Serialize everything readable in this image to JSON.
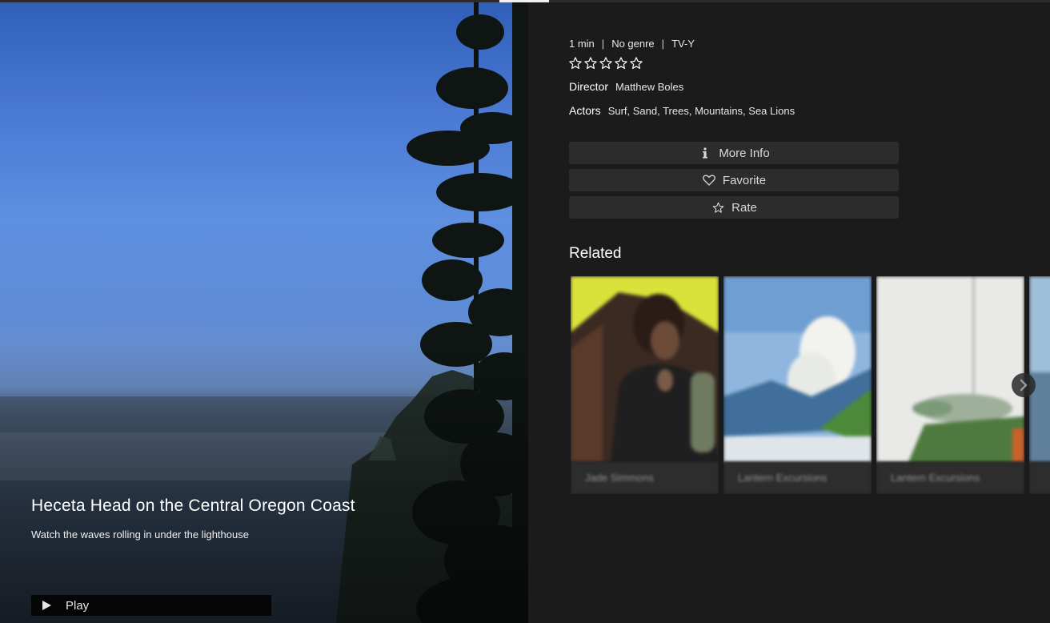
{
  "playback": {
    "progress": 0.047
  },
  "hero": {
    "title": "Heceta Head on the Central Oregon Coast",
    "description": "Watch the waves rolling in under the lighthouse",
    "play_label": "Play"
  },
  "details": {
    "duration": "1 min",
    "genre": "No genre",
    "rating": "TV-Y",
    "user_stars": {
      "filled": 0,
      "max": 5
    },
    "director_label": "Director",
    "director": "Matthew Boles",
    "actors_label": "Actors",
    "actors": "Surf, Sand, Trees, Mountains, Sea Lions"
  },
  "actions": {
    "more_info": "More Info",
    "favorite": "Favorite",
    "rate": "Rate"
  },
  "related": {
    "heading": "Related",
    "items": [
      {
        "caption": "Jade Simmons"
      },
      {
        "caption": "Lantern Excursions"
      },
      {
        "caption": "Lantern Excursions"
      },
      {
        "caption": ""
      }
    ]
  },
  "colors": {
    "background": "#1b1b1b",
    "button_bg": "#2c2c2c",
    "text_primary": "#ffffff",
    "text_secondary": "#d8d8d8"
  }
}
